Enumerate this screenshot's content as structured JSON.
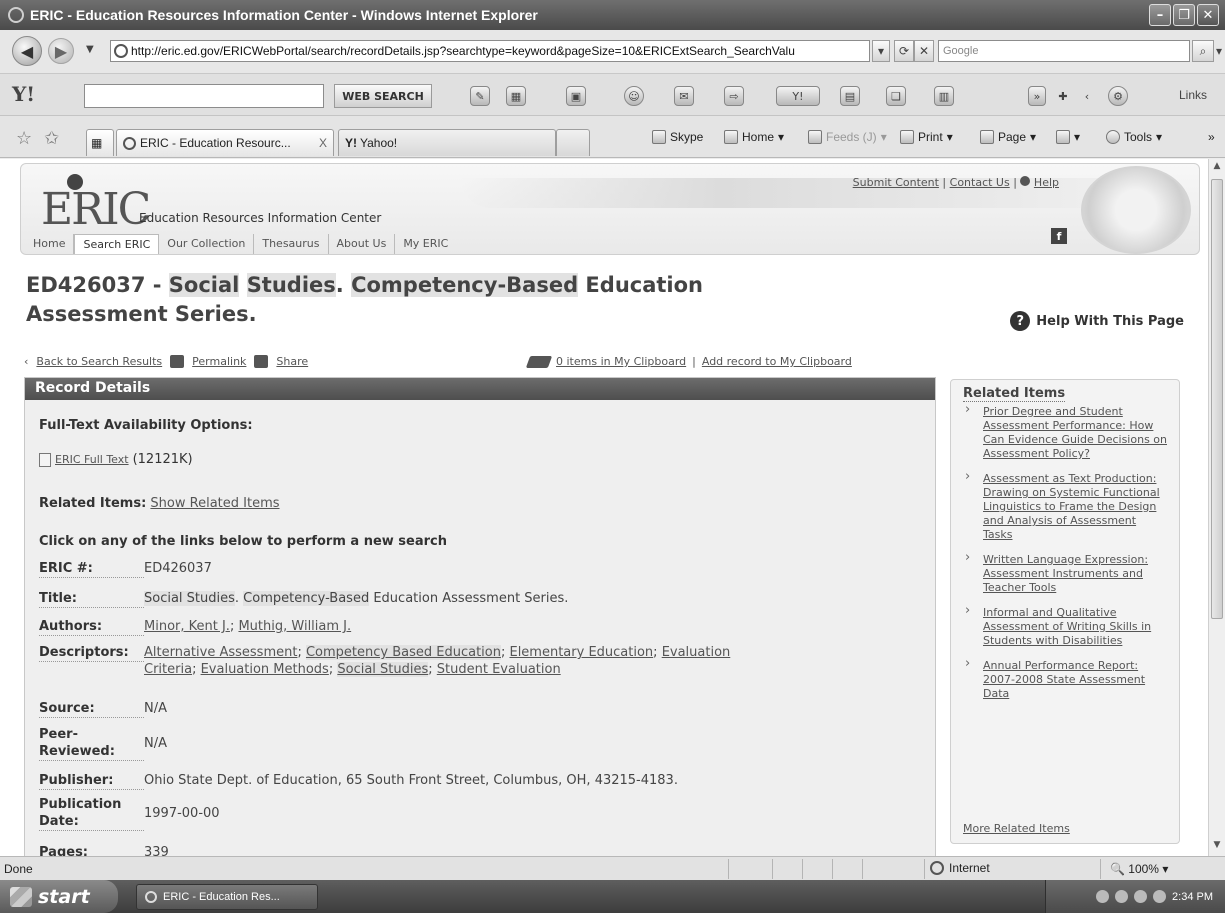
{
  "window": {
    "title": "ERIC - Education Resources Information Center - Windows Internet Explorer",
    "minimize": "–",
    "maximize": "❐",
    "close": "✕"
  },
  "addressbar": {
    "url": "http://eric.ed.gov/ERICWebPortal/search/recordDetails.jsp?searchtype=keyword&pageSize=10&ERICExtSearch_SearchValu",
    "search_placeholder": "Google"
  },
  "yahoo_toolbar": {
    "logo": "Y!",
    "search_button": "WEB SEARCH",
    "links_label": "Links"
  },
  "tabs": [
    {
      "label": "ERIC - Education Resourc...",
      "close": "X"
    },
    {
      "label": "Yahoo!"
    }
  ],
  "command_bar": {
    "skype": "Skype",
    "home": "Home",
    "feeds": "Feeds (J)",
    "print": "Print",
    "page": "Page",
    "tools": "Tools"
  },
  "eric_header": {
    "logo": "ERIC",
    "subtitle": "Education Resources Information Center",
    "top_links": [
      "Submit Content",
      "Contact Us",
      "Help"
    ],
    "nav": [
      "Home",
      "Search ERIC",
      "Our Collection",
      "Thesaurus",
      "About Us",
      "My ERIC"
    ],
    "facebook": "f"
  },
  "record": {
    "id_prefix": "ED426037 - ",
    "title_part1": "Social",
    "title_part2": "Studies",
    "title_part3": ". ",
    "title_part4": "Competency-Based",
    "title_part5": " Education",
    "title_part6": "Assessment Series.",
    "help_with_page": "Help With This Page"
  },
  "subnav": {
    "back": "Back to Search Results",
    "permalink": "Permalink",
    "share": "Share",
    "clipboard_count": "0 items in My Clipboard",
    "add_clipboard": "Add record to My Clipboard"
  },
  "record_details": {
    "heading": "Record Details",
    "fulltext_label": "Full-Text Availability Options:",
    "fulltext_link": "ERIC Full Text",
    "fulltext_size": " (12121K)",
    "related_label": "Related Items:",
    "related_link": "Show Related Items",
    "click_note": "Click on any of the links below to perform a new search",
    "fields": {
      "eric_num_k": "ERIC #:",
      "eric_num_v": "ED426037",
      "title_k": "Title:",
      "title_v1": "Social Studies",
      "title_v2": ". ",
      "title_v3": "Competency-Based",
      "title_v4": " Education Assessment Series.",
      "authors_k": "Authors:",
      "author1": "Minor, Kent J.",
      "author2": "Muthig, William J.",
      "descriptors_k": "Descriptors:",
      "desc1": "Alternative Assessment",
      "desc2": "Competency Based Education",
      "desc3": "Elementary Education",
      "desc4": "Evaluation",
      "desc5": "Criteria",
      "desc6": "Evaluation Methods",
      "desc7": "Social Studies",
      "desc8": "Student Evaluation",
      "source_k": "Source:",
      "source_v": "N/A",
      "peer_k1": "Peer-",
      "peer_k2": "Reviewed:",
      "peer_v": "N/A",
      "publisher_k": "Publisher:",
      "publisher_v": "Ohio State Dept. of Education, 65 South Front Street, Columbus, OH, 43215-4183.",
      "pubdate_k1": "Publication",
      "pubdate_k2": "Date:",
      "pubdate_v": "1997-00-00",
      "pages_k": "Pages:",
      "pages_v": "339"
    }
  },
  "related_items": {
    "heading": "Related Items",
    "items": [
      "Prior Degree and Student Assessment Performance: How Can Evidence Guide Decisions on Assessment Policy?",
      "Assessment as Text Production: Drawing on Systemic Functional Linguistics to Frame the Design and Analysis of Assessment Tasks",
      "Written Language Expression: Assessment Instruments and Teacher Tools",
      "Informal and Qualitative Assessment of Writing Skills in Students with Disabilities",
      "Annual Performance Report: 2007-2008 State Assessment Data"
    ],
    "more": "More Related Items"
  },
  "statusbar": {
    "status": "Done",
    "zone": "Internet",
    "zoom": "100%"
  },
  "taskbar": {
    "start": "start",
    "item": "ERIC - Education Res...",
    "time": "2:34 PM"
  }
}
